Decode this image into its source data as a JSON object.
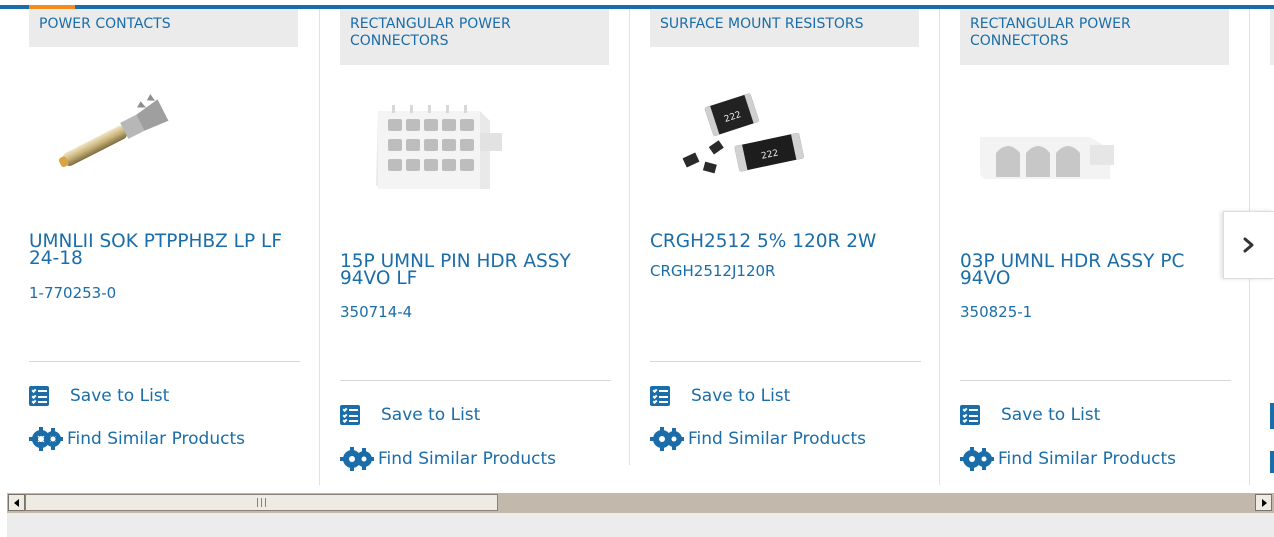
{
  "products": [
    {
      "category": "POWER CONTACTS",
      "name": "UMNLII SOK PTPPHBZ LP LF 24-18",
      "part_number": "1-770253-0",
      "image_icon": "power-contact-product-image"
    },
    {
      "category": "RECTANGULAR POWER CONNECTORS",
      "name": "15P UMNL PIN HDR ASSY 94VO LF",
      "part_number": "350714-4",
      "image_icon": "rectangular-connector-15p-product-image"
    },
    {
      "category": "SURFACE MOUNT RESISTORS",
      "name": "CRGH2512 5% 120R 2W",
      "part_number": "CRGH2512J120R",
      "image_icon": "smd-resistor-product-image",
      "resistor_marking": "222"
    },
    {
      "category": "RECTANGULAR POWER CONNECTORS",
      "name": "03P UMNL HDR ASSY PC 94VO",
      "part_number": "350825-1",
      "image_icon": "rectangular-connector-3p-product-image"
    }
  ],
  "actions": {
    "save_label": "Save to List",
    "similar_label": "Find Similar Products"
  },
  "carousel": {
    "next_icon": "chevron-right-icon"
  },
  "colors": {
    "accent": "#1a6da8",
    "highlight": "#f28c1e",
    "category_bg": "#ebebeb"
  }
}
